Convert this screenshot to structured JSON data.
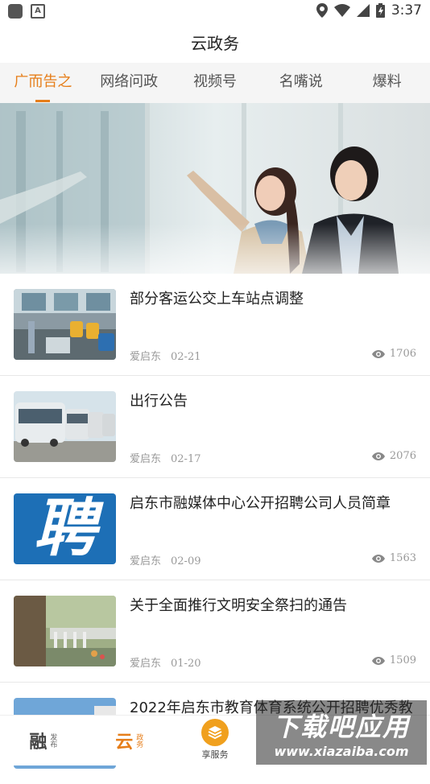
{
  "status_bar": {
    "time": "3:37"
  },
  "header": {
    "title": "云政务"
  },
  "tabs": [
    {
      "label": "广而告之",
      "active": true
    },
    {
      "label": "网络问政",
      "active": false
    },
    {
      "label": "视频号",
      "active": false
    },
    {
      "label": "名嘴说",
      "active": false
    },
    {
      "label": "爆料",
      "active": false
    }
  ],
  "articles": [
    {
      "title": "部分客运公交上车站点调整",
      "source": "爱启东",
      "date": "02-21",
      "views": "1706",
      "thumb": "bus-interior"
    },
    {
      "title": "出行公告",
      "source": "爱启东",
      "date": "02-17",
      "views": "2076",
      "thumb": "buses"
    },
    {
      "title": "启东市融媒体中心公开招聘公司人员简章",
      "source": "爱启东",
      "date": "02-09",
      "views": "1563",
      "thumb": "recruit",
      "thumb_text": "聘"
    },
    {
      "title": "关于全面推行文明安全祭扫的通告",
      "source": "爱启东",
      "date": "01-20",
      "views": "1509",
      "thumb": "cemetery"
    },
    {
      "title": "2022年启东市教育体育系统公开招聘优秀教",
      "thumb": "sky"
    }
  ],
  "bottom_nav": [
    {
      "big": "融",
      "small": "发布",
      "active": false
    },
    {
      "big": "云",
      "small": "政务",
      "active": true
    },
    {
      "label": "享服务",
      "active": false
    }
  ],
  "watermark": {
    "big": "下载吧应用",
    "small": "www.xiazaiba.com"
  },
  "colors": {
    "accent": "#e67e1a",
    "tab_bg": "#f5f5f5",
    "meta": "#999999"
  }
}
